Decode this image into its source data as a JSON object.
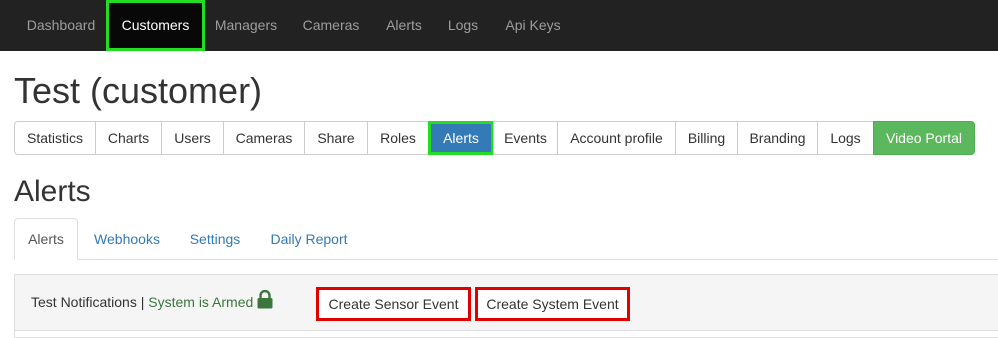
{
  "nav": {
    "items": [
      "Dashboard",
      "Customers",
      "Managers",
      "Cameras",
      "Alerts",
      "Logs",
      "Api Keys"
    ],
    "active": "Customers"
  },
  "page_title": "Test (customer)",
  "customer_tabs": {
    "items": [
      "Statistics",
      "Charts",
      "Users",
      "Cameras",
      "Share",
      "Roles",
      "Alerts",
      "Events",
      "Account profile",
      "Billing",
      "Branding",
      "Logs",
      "Video Portal"
    ],
    "active": "Alerts",
    "highlight": "Video Portal"
  },
  "section_title": "Alerts",
  "alert_tabs": {
    "items": [
      "Alerts",
      "Webhooks",
      "Settings",
      "Daily Report"
    ],
    "active": "Alerts"
  },
  "panel": {
    "label": "Test Notifications",
    "separator": "|",
    "status": "System is Armed",
    "status_icon": "lock-icon",
    "create_sensor_label": "Create Sensor Event",
    "create_system_label": "Create System Event"
  },
  "colors": {
    "navbar_bg": "#222222",
    "primary": "#337ab7",
    "success": "#5cb85c",
    "status_green": "#3c763d",
    "highlight_green": "#22dd22",
    "highlight_red": "#e00000"
  }
}
